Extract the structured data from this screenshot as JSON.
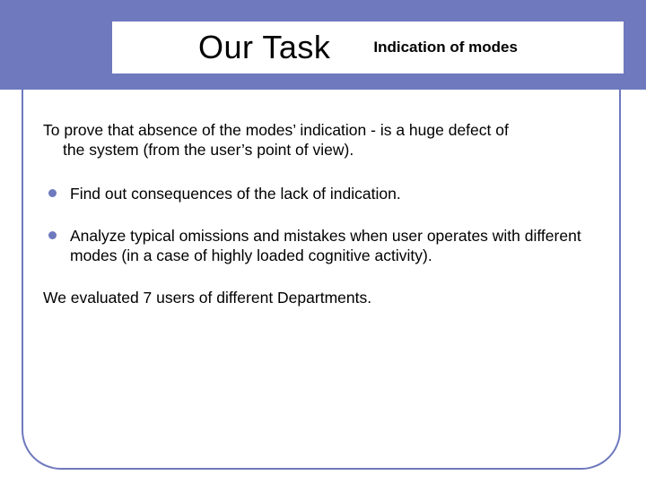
{
  "header": {
    "title": "Our Task",
    "subtitle": "Indication of modes"
  },
  "body": {
    "intro_line1": "To prove that absence of the modes’ indication - is a huge defect of",
    "intro_line2": "the system (from the user’s point of view).",
    "bullets": [
      "Find out consequences of the lack of indication.",
      "Analyze typical omissions and mistakes when user operates with different modes (in a case of highly loaded cognitive activity)."
    ],
    "outro": "We evaluated 7 users of different Departments."
  },
  "colors": {
    "accent": "#6e79be",
    "text": "#000000",
    "background": "#ffffff"
  }
}
